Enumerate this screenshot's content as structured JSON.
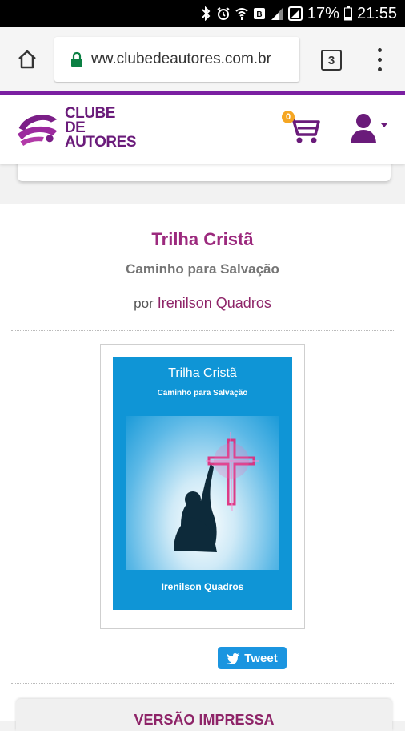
{
  "status_bar": {
    "battery_percent": "17%",
    "time": "21:55",
    "icons": [
      "bluetooth-icon",
      "alarm-icon",
      "wifi-icon",
      "data-icon",
      "signal-icon",
      "sim-icon",
      "battery-icon"
    ]
  },
  "browser": {
    "url": "ww.clubedeautores.com.br",
    "tab_count": "3",
    "accent_color": "#7b1fa2"
  },
  "site": {
    "logo_line1": "CLUBE DE",
    "logo_line2": "AUTORES",
    "cart_count": "0",
    "brand_color": "#6a1b7a"
  },
  "book": {
    "title": "Trilha Cristã",
    "subtitle": "Caminho para Salvação",
    "by_label": "por",
    "author": "Irenilson Quadros"
  },
  "cover": {
    "title": "Trilha Cristã",
    "subtitle": "Caminho para Salvação",
    "author": "Irenilson Quadros"
  },
  "share": {
    "tweet_label": "Tweet"
  },
  "next_section": {
    "label": "VERSÃO IMPRESSA"
  }
}
